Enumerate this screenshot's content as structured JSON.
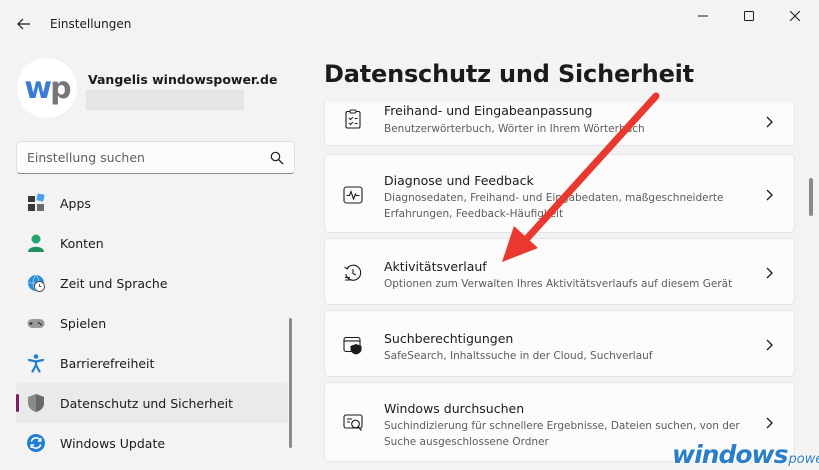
{
  "window": {
    "title": "Einstellungen"
  },
  "profile": {
    "avatar_text_w": "w",
    "avatar_text_p": "p",
    "name": "Vangelis windowspower.de"
  },
  "search": {
    "placeholder": "Einstellung suchen"
  },
  "sidebar": {
    "items": [
      {
        "label": "Apps",
        "icon": "apps-icon"
      },
      {
        "label": "Konten",
        "icon": "account-icon"
      },
      {
        "label": "Zeit und Sprache",
        "icon": "globe-clock-icon"
      },
      {
        "label": "Spielen",
        "icon": "gamepad-icon"
      },
      {
        "label": "Barrierefreiheit",
        "icon": "accessibility-icon"
      },
      {
        "label": "Datenschutz und Sicherheit",
        "icon": "shield-icon",
        "active": true
      },
      {
        "label": "Windows Update",
        "icon": "update-icon"
      }
    ]
  },
  "main": {
    "title": "Datenschutz und Sicherheit",
    "cards": [
      {
        "title": "Freihand- und Eingabeanpassung",
        "desc": "Benutzerwörterbuch, Wörter in Ihrem Wörterbuch",
        "icon": "clipboard-list-icon"
      },
      {
        "title": "Diagnose und Feedback",
        "desc": "Diagnosedaten, Freihand- und Eingabedaten, maßgeschneiderte Erfahrungen, Feedback-Häufigkeit",
        "icon": "diagnostics-icon"
      },
      {
        "title": "Aktivitätsverlauf",
        "desc": "Optionen zum Verwalten Ihres Aktivitätsverlaufs auf diesem Gerät",
        "icon": "history-icon"
      },
      {
        "title": "Suchberechtigungen",
        "desc": "SafeSearch, Inhaltssuche in der Cloud, Suchverlauf",
        "icon": "search-permissions-icon"
      },
      {
        "title": "Windows durchsuchen",
        "desc": "Suchindizierung für schnellere Ergebnisse, Dateien suchen, von der Suche ausgeschlossene Ordner",
        "icon": "search-windows-icon"
      }
    ]
  },
  "watermark": {
    "main": "windows",
    "sub": "power"
  },
  "colors": {
    "accent": "#7a1f5f",
    "arrow": "#e8382f",
    "watermark": "#2b7fc9"
  }
}
